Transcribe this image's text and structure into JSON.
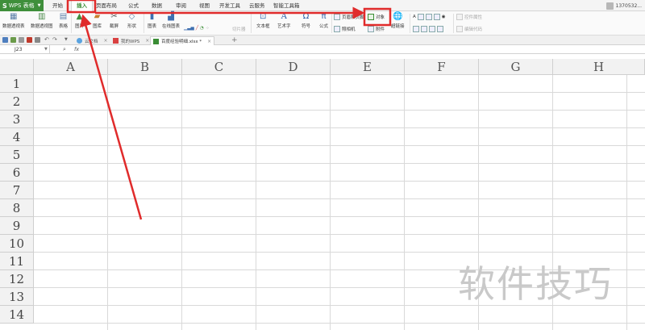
{
  "app": {
    "logo_text": "S",
    "name": "WPS 表格",
    "user": "1370532..."
  },
  "menu": {
    "tabs": [
      {
        "label": "开始"
      },
      {
        "label": "插入",
        "active": true
      },
      {
        "label": "页面布局"
      },
      {
        "label": "公式"
      },
      {
        "label": "数据"
      },
      {
        "label": "审阅"
      },
      {
        "label": "视图"
      },
      {
        "label": "开发工具"
      },
      {
        "label": "云服务"
      },
      {
        "label": "智能工具箱"
      }
    ]
  },
  "ribbon": {
    "pivot_table": "数据透视表",
    "pivot_chart": "数据透视图",
    "table": "表格",
    "picture": "图片",
    "gallery": "图库",
    "screenshot": "截屏",
    "shapes": "形状",
    "chart": "图表",
    "online_chart": "在线图表",
    "slicer": "切片器",
    "textbox": "文本框",
    "wordart": "艺术字",
    "symbol": "符号",
    "formula": "公式",
    "header_footer": "页眉和页脚",
    "object": "对象",
    "camera": "照相机",
    "attachment": "附件",
    "hyperlink": "超链接",
    "control_props": "控件属性",
    "edit_code": "编辑代码"
  },
  "doc_tabs": [
    {
      "label": "云文档"
    },
    {
      "label": "我的WPS"
    },
    {
      "label": "百度经验明细.xlsx *",
      "active": true
    }
  ],
  "formula_bar": {
    "name_box": "J23",
    "fx": "fx",
    "value": ""
  },
  "sheet": {
    "columns": [
      "A",
      "B",
      "C",
      "D",
      "E",
      "F",
      "G",
      "H"
    ],
    "rows": [
      "1",
      "2",
      "3",
      "4",
      "5",
      "6",
      "7",
      "8",
      "9",
      "10",
      "11",
      "12",
      "13",
      "14"
    ]
  },
  "watermark": "软件技巧",
  "colors": {
    "wps_green": "#3f8f3b",
    "annotation_red": "#e02b2b"
  }
}
